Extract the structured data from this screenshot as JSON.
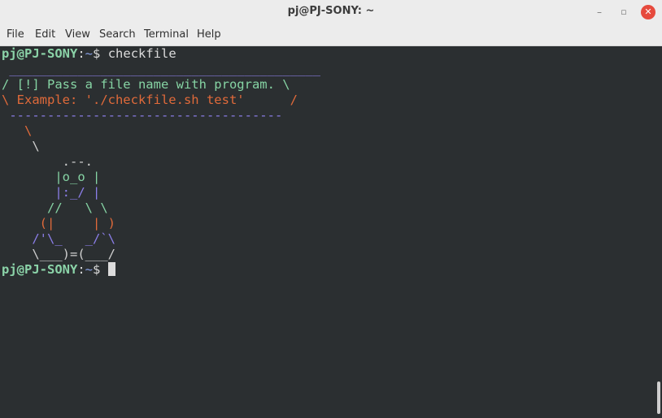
{
  "window": {
    "title": "pj@PJ-SONY: ~",
    "controls": {
      "minimize": "–",
      "maximize": "▫",
      "close": "✕"
    }
  },
  "menu": [
    "File",
    "Edit",
    "View",
    "Search",
    "Terminal",
    "Help"
  ],
  "terminal": {
    "prompt": {
      "user_host": "pj@PJ-SONY",
      "sep": ":",
      "path": "~",
      "dollar": "$"
    },
    "command": "checkfile",
    "bubble": {
      "top_border": " _________________________________________",
      "line1": "/ [!] Pass a file name with program. \\",
      "line2": "\\ Example: './checkfile.sh test'      /",
      "bottom_border": " ------------------------------------"
    },
    "art": [
      "   \\",
      "    \\",
      "        .--.",
      "       |o_o |",
      "       |:_/ |",
      "      //   \\ \\",
      "     (|     | )",
      "    /'\\_   _/`\\",
      "    \\___)=(___/"
    ]
  },
  "colors": {
    "terminal_bg": "#2b2f31",
    "green": "#86d4a4",
    "orange": "#e06a3a",
    "purple": "#8b7ee8"
  }
}
